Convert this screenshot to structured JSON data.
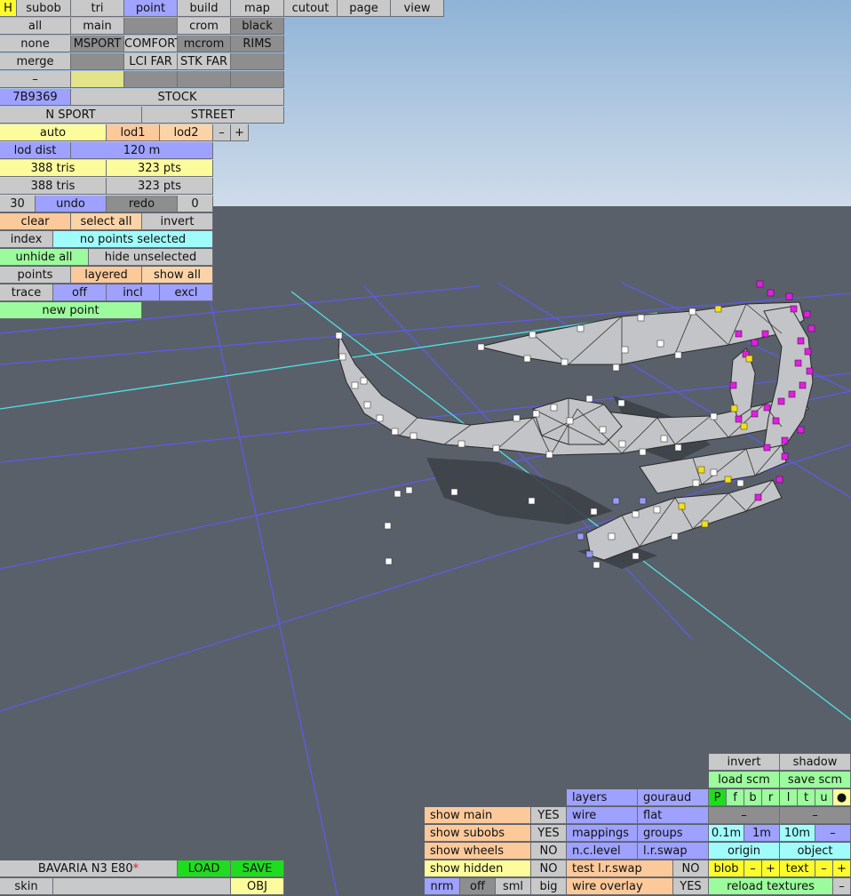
{
  "menu": {
    "h": "H",
    "tabs": [
      "subob",
      "tri",
      "point",
      "build",
      "map",
      "cutout",
      "page",
      "view"
    ],
    "active": "point"
  },
  "row1": [
    "all",
    "main",
    "",
    "crom",
    "black"
  ],
  "row2": [
    "none",
    "MSPORT",
    "COMFORT",
    "mcrom",
    "RIMS"
  ],
  "row3": [
    "merge",
    "",
    "LCI FAR",
    "STK FAR",
    ""
  ],
  "row4": [
    "–",
    "",
    "",
    "",
    ""
  ],
  "codes": [
    "7B9369",
    "STOCK"
  ],
  "variants": [
    "N SPORT",
    "STREET"
  ],
  "lod": {
    "auto": "auto",
    "lod1": "lod1",
    "lod2": "lod2",
    "minus": "–",
    "plus": "+"
  },
  "lod_dist": {
    "label": "lod dist",
    "value": "120 m"
  },
  "stats1": {
    "tris": "388 tris",
    "pts": "323 pts"
  },
  "stats2": {
    "tris": "388 tris",
    "pts": "323 pts"
  },
  "undo_row": {
    "count": "30",
    "undo": "undo",
    "redo": "redo",
    "redo_count": "0"
  },
  "select_row": {
    "clear": "clear",
    "select_all": "select all",
    "invert": "invert"
  },
  "index_row": {
    "index": "index",
    "status": "no points selected"
  },
  "hide_row": {
    "unhide": "unhide all",
    "hide": "hide unselected"
  },
  "points_row": {
    "points": "points",
    "layered": "layered",
    "show_all": "show all"
  },
  "trace_row": {
    "trace": "trace",
    "off": "off",
    "incl": "incl",
    "excl": "excl"
  },
  "new_point": "new point",
  "bottom_left": {
    "car_name": "BAVARIA N3 E80",
    "asterisk": "*",
    "load": "LOAD",
    "save": "SAVE",
    "skin": "skin",
    "obj": "OBJ"
  },
  "show_panel": [
    {
      "label": "show main",
      "value": "YES"
    },
    {
      "label": "show subobs",
      "value": "YES"
    },
    {
      "label": "show wheels",
      "value": "NO"
    },
    {
      "label": "show hidden",
      "value": "NO"
    }
  ],
  "normals": [
    "nrm",
    "off",
    "sml",
    "big"
  ],
  "render_panel": {
    "layers": "layers",
    "gouraud": "gouraud",
    "wire": "wire",
    "flat": "flat",
    "mappings": "mappings",
    "groups": "groups",
    "nclevel": "n.c.level",
    "lrswap": "l.r.swap",
    "test_lrswap": "test l.r.swap",
    "test_value": "NO",
    "wire_overlay": "wire overlay",
    "wire_value": "YES"
  },
  "right_panel": {
    "invert": "invert",
    "shadow": "shadow",
    "load_scm": "load scm",
    "save_scm": "save scm",
    "views": [
      "P",
      "f",
      "b",
      "r",
      "l",
      "t",
      "u",
      "●"
    ],
    "dash1": "–",
    "dash2": "–",
    "grid": [
      "0.1m",
      "1m",
      "10m",
      "–"
    ],
    "origin": "origin",
    "object": "object",
    "blob": "blob",
    "text": "text",
    "minus": "–",
    "plus": "+",
    "reload": "reload textures",
    "last": "–"
  },
  "colors": {
    "sky": "#bcd3e8",
    "ground": "#59606a",
    "grid": "#6460f0",
    "axis": "#58e8e8",
    "mesh": "#c4c4c8",
    "point": "#ffffff",
    "selected": "#e020e0",
    "highlight": "#f0e020"
  }
}
